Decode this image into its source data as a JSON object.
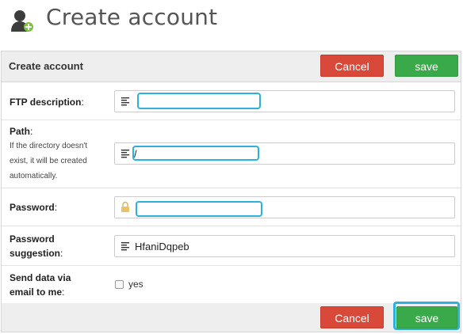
{
  "page": {
    "title": "Create account",
    "icon": "user-add-icon"
  },
  "panel": {
    "title": "Create account",
    "cancel_label": "Cancel",
    "save_label": "save"
  },
  "form": {
    "ftp_description": {
      "label": "FTP description",
      "colon": ":",
      "value": ""
    },
    "path": {
      "label": "Path",
      "colon": ":",
      "help_lines": [
        "If the directory doesn't",
        "exist, it will be created",
        "automatically."
      ],
      "value": "/"
    },
    "password": {
      "label": "Password",
      "colon": ":",
      "value": ""
    },
    "password_suggestion": {
      "label_line1": "Password",
      "label_line2": "suggestion",
      "colon": ":",
      "value": "HfaniDqpeb"
    },
    "send_email": {
      "label_line1": "Send data via",
      "label_line2": "email to me",
      "colon": ":",
      "checkbox_label": "yes",
      "checked": false
    }
  },
  "footer": {
    "cancel_label": "Cancel",
    "save_label": "save"
  },
  "colors": {
    "cancel": "#d9493a",
    "save": "#3aa94a",
    "focus": "#2cb0dc",
    "header_bg": "#eeeeee"
  }
}
